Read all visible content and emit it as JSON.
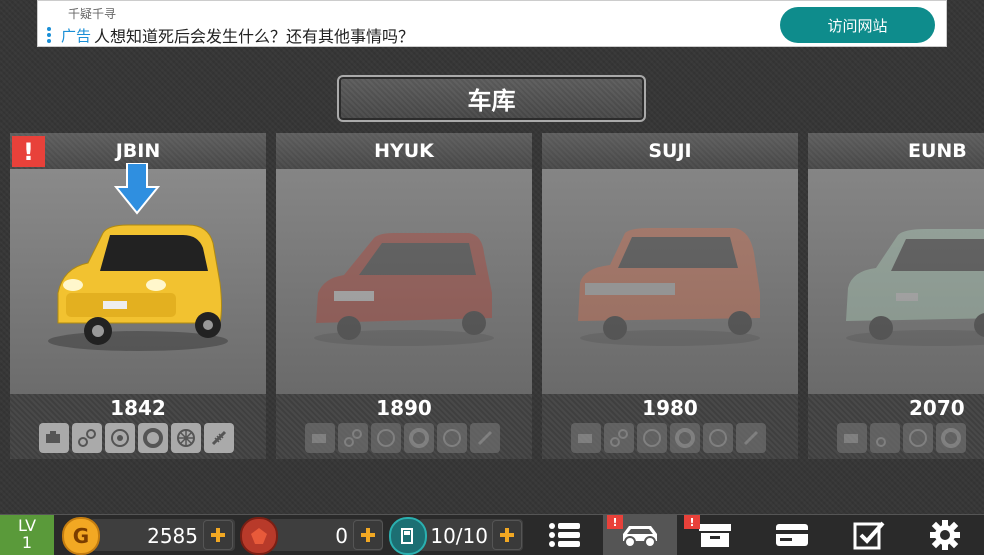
{
  "ad": {
    "source": "千疑千寻",
    "tag": "广告",
    "text": "人想知道死后会发生什么？还有其他事情吗？",
    "button_label": "访问网站"
  },
  "title": "车库",
  "cars": [
    {
      "name": "JBIN",
      "price": "1842",
      "color": "#f2c230",
      "locked": false,
      "alert": "!"
    },
    {
      "name": "HYUK",
      "price": "1890",
      "color": "#c0392b",
      "locked": true
    },
    {
      "name": "SUJI",
      "price": "1980",
      "color": "#e8704a",
      "locked": true
    },
    {
      "name": "EUNB",
      "price": "2070",
      "color": "#b9e0c8",
      "locked": true
    }
  ],
  "parts_icons": [
    "engine-icon",
    "gear-belt-icon",
    "turbo-icon",
    "tire-icon",
    "wheel-icon",
    "suspension-icon"
  ],
  "bottom": {
    "level_label": "LV",
    "level_value": "1",
    "gold": "2585",
    "gems": "0",
    "fuel": "10/10",
    "nav": [
      "list-icon",
      "car-icon",
      "storage-icon",
      "card-icon",
      "checklist-icon",
      "settings-icon"
    ],
    "nav_alert": "!"
  }
}
